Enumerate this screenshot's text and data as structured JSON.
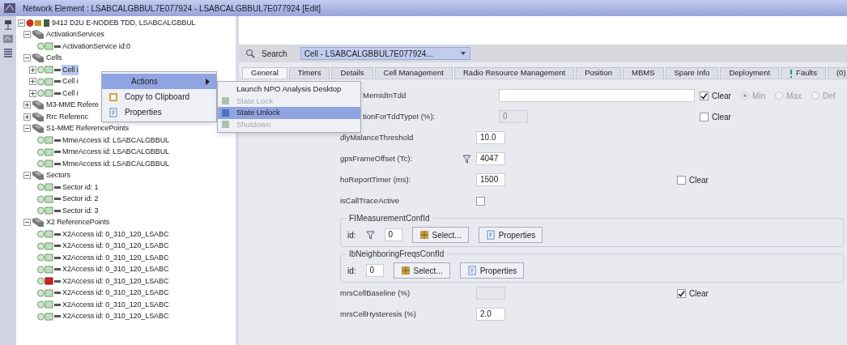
{
  "window": {
    "title": "Network Element : LSABCALGBBUL7E077924 - LSABCALGBBUL7E077924 [Edit]"
  },
  "tree": {
    "kind": "root",
    "label": "9412 D2U E-NODEB TDD, LSABCALGBBUL",
    "expanded": true,
    "children": [
      {
        "kind": "folder",
        "label": "ActivationServices",
        "expanded": true,
        "children": [
          {
            "kind": "object",
            "label": "ActivationService id:0",
            "alarm": false
          }
        ]
      },
      {
        "kind": "folder",
        "label": "Cells",
        "expanded": true,
        "children": [
          {
            "kind": "object",
            "label": "Cell i",
            "alarm": false,
            "expanded": false,
            "selected": true
          },
          {
            "kind": "object",
            "label": "Cell i",
            "alarm": false,
            "expanded": false,
            "selected": false
          },
          {
            "kind": "object",
            "label": "Cell i",
            "alarm": false,
            "expanded": false,
            "selected": false
          }
        ]
      },
      {
        "kind": "folder",
        "label": "M3-MME Refere",
        "expanded": false
      },
      {
        "kind": "folder",
        "label": "Rrc Referenc",
        "expanded": false
      },
      {
        "kind": "folder",
        "label": "S1-MME ReferencePoints",
        "expanded": true,
        "children": [
          {
            "kind": "object",
            "label": "MmeAccess id: LSABCALGBBUL",
            "alarm": false
          },
          {
            "kind": "object",
            "label": "MmeAccess id: LSABCALGBBUL",
            "alarm": false
          },
          {
            "kind": "object",
            "label": "MmeAccess id: LSABCALGBBUL",
            "alarm": false
          }
        ]
      },
      {
        "kind": "folder",
        "label": "Sectors",
        "expanded": true,
        "children": [
          {
            "kind": "object",
            "label": "Sector id: 1",
            "alarm": false
          },
          {
            "kind": "object",
            "label": "Sector id: 2",
            "alarm": false
          },
          {
            "kind": "object",
            "label": "Sector id: 3",
            "alarm": false
          }
        ]
      },
      {
        "kind": "folder",
        "label": "X2 ReferencePoints",
        "expanded": true,
        "children": [
          {
            "kind": "object",
            "label": "X2Access id: 0_310_120_LSABC",
            "alarm": false
          },
          {
            "kind": "object",
            "label": "X2Access id: 0_310_120_LSABC",
            "alarm": false
          },
          {
            "kind": "object",
            "label": "X2Access id: 0_310_120_LSABC",
            "alarm": false
          },
          {
            "kind": "object",
            "label": "X2Access id: 0_310_120_LSABC",
            "alarm": false
          },
          {
            "kind": "object",
            "label": "X2Access id: 0_310_120_LSABC",
            "alarm": true
          },
          {
            "kind": "object",
            "label": "X2Access id: 0_310_120_LSABC",
            "alarm": false
          },
          {
            "kind": "object",
            "label": "X2Access id: 0_310_120_LSABC",
            "alarm": false
          },
          {
            "kind": "object",
            "label": "X2Access id: 0_310_120_LSABC",
            "alarm": false
          }
        ]
      }
    ]
  },
  "search": {
    "label": "Search",
    "value": "Cell - LSABCALGBBUL7E077924..."
  },
  "tabs": [
    {
      "label": "General",
      "selected": true
    },
    {
      "label": "Timers",
      "selected": false
    },
    {
      "label": "Details",
      "selected": false
    },
    {
      "label": "Cell Management",
      "selected": false
    },
    {
      "label": "Radio Resource Management",
      "selected": false
    },
    {
      "label": "Position",
      "selected": false
    },
    {
      "label": "MBMS",
      "selected": false
    },
    {
      "label": "Spare Info",
      "selected": false
    },
    {
      "label": "Deployment",
      "selected": false
    },
    {
      "label": "Faults",
      "selected": false,
      "warning": true
    },
    {
      "label": "(0)",
      "selected": false
    }
  ],
  "form": [
    {
      "kind": "text",
      "label": "MemIdInTdd",
      "wide": true,
      "clear": {
        "label": "Clear",
        "checked": true
      },
      "radios": [
        {
          "label": "Min",
          "selected": true
        },
        {
          "label": "Max",
          "selected": false
        },
        {
          "label": "Def",
          "selected": false
        }
      ]
    },
    {
      "kind": "text",
      "label": "tionForTddTypeI (%):",
      "value": "0",
      "disabled": true,
      "clear": {
        "label": "Clear",
        "checked": false
      }
    },
    {
      "kind": "text",
      "label": "dlyMalanceThreshold",
      "value": "10.0"
    },
    {
      "kind": "text",
      "label": "gpsFrameOffset (Tc):",
      "value": "4047",
      "filter": true
    },
    {
      "kind": "text",
      "label": "hoReportTimer (ms):",
      "value": "1500",
      "clear": {
        "label": "Clear",
        "checked": false
      }
    },
    {
      "kind": "checkbox",
      "label": "isCallTraceActive",
      "checked": false
    },
    {
      "kind": "group",
      "title": "FIMeasurementConfId",
      "id_label": "id:",
      "value": "0",
      "filter": true,
      "buttons": [
        "Select...",
        "Properties"
      ]
    },
    {
      "kind": "group",
      "title": "IbNeighboringFreqsConfId",
      "id_label": "id:",
      "value": "0",
      "filter": false,
      "buttons": [
        "Select...",
        "Properties"
      ]
    },
    {
      "kind": "text",
      "label": "mrsCellBaseline (%)",
      "disabled": true,
      "clear": {
        "label": "Clear",
        "checked": true
      }
    },
    {
      "kind": "text",
      "label": "mrsCellHysteresis (%)",
      "value": "2.0"
    }
  ],
  "context_menu": {
    "items": [
      {
        "label": "Actions",
        "submenu": true,
        "selected": true
      },
      {
        "label": "Copy to Clipboard",
        "submenu": false,
        "selected": false
      },
      {
        "label": "Properties",
        "submenu": false,
        "selected": false
      }
    ]
  },
  "submenu": {
    "items": [
      {
        "label": "Launch NPO Analysis Desktop",
        "disabled": false,
        "selected": false,
        "icon": false
      },
      {
        "label": "State Lock",
        "disabled": true,
        "selected": false,
        "icon": true
      },
      {
        "label": "State Unlock",
        "disabled": false,
        "selected": true,
        "icon": true
      },
      {
        "label": "Shutdown",
        "disabled": true,
        "selected": false,
        "icon": true
      }
    ]
  }
}
